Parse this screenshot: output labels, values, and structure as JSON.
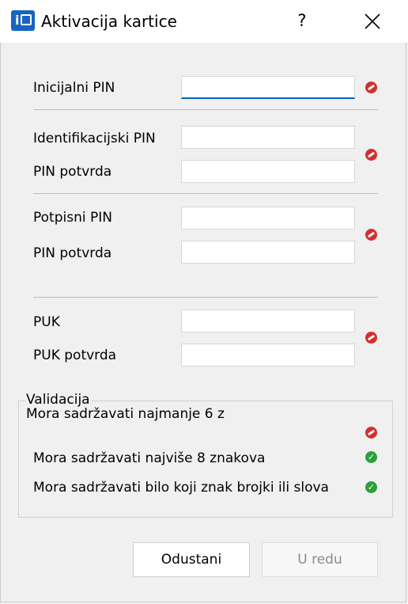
{
  "window": {
    "title": "Aktivacija kartice",
    "help_label": "?",
    "app_icon_letter": "i"
  },
  "form": {
    "initial_pin_label": "Inicijalni PIN",
    "identification_pin_label": "Identifikacijski PIN",
    "identification_confirm_label": "PIN potvrda",
    "signing_pin_label": "Potpisni PIN",
    "signing_confirm_label": "PIN potvrda",
    "puk_label": "PUK",
    "puk_confirm_label": "PUK potvrda",
    "initial_pin_value": "",
    "identification_pin_value": "",
    "identification_confirm_value": "",
    "signing_pin_value": "",
    "signing_confirm_value": "",
    "puk_value": "",
    "puk_confirm_value": ""
  },
  "validation": {
    "title": "Validacija",
    "rules": [
      {
        "text": "Mora sadržavati najmanje 6 z",
        "status": "error"
      },
      {
        "text": "Mora sadržavati najviše 8 znakova",
        "status": "ok"
      },
      {
        "text": "Mora sadržavati bilo koji znak brojki ili slova",
        "status": "ok"
      }
    ]
  },
  "buttons": {
    "cancel_label": "Odustani",
    "ok_label": "U redu"
  },
  "icons": {
    "error": "error-icon",
    "ok": "check-icon",
    "close": "close-icon"
  },
  "colors": {
    "accent": "#0067c0",
    "error": "#d32f2f",
    "ok": "#2e9e3a",
    "app_icon": "#1565c0"
  }
}
